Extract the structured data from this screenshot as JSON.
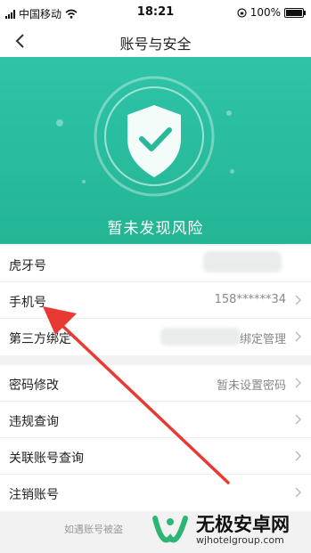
{
  "status_bar": {
    "carrier": "中国移动",
    "time": "18:21",
    "battery": "100%"
  },
  "nav": {
    "title": "账号与安全"
  },
  "hero": {
    "status_text": "暂未发现风险"
  },
  "account_rows": [
    {
      "label": "虎牙号",
      "value": ""
    },
    {
      "label": "手机号",
      "value": "158******34"
    },
    {
      "label": "第三方绑定",
      "value": "绑定管理"
    }
  ],
  "security_rows": [
    {
      "label": "密码修改",
      "value": "暂未设置密码"
    },
    {
      "label": "违规查询",
      "value": ""
    },
    {
      "label": "关联账号查询",
      "value": ""
    },
    {
      "label": "注销账号",
      "value": ""
    }
  ],
  "footer": {
    "text": "如遇账号被盗"
  },
  "watermark": {
    "name": "无极安卓网",
    "url": "wjhotelgroup.com"
  },
  "colors": {
    "hero_top": "#2fc4a8",
    "hero_bottom": "#23b594",
    "arrow": "#e83a32",
    "brand_green": "#2bb673"
  }
}
